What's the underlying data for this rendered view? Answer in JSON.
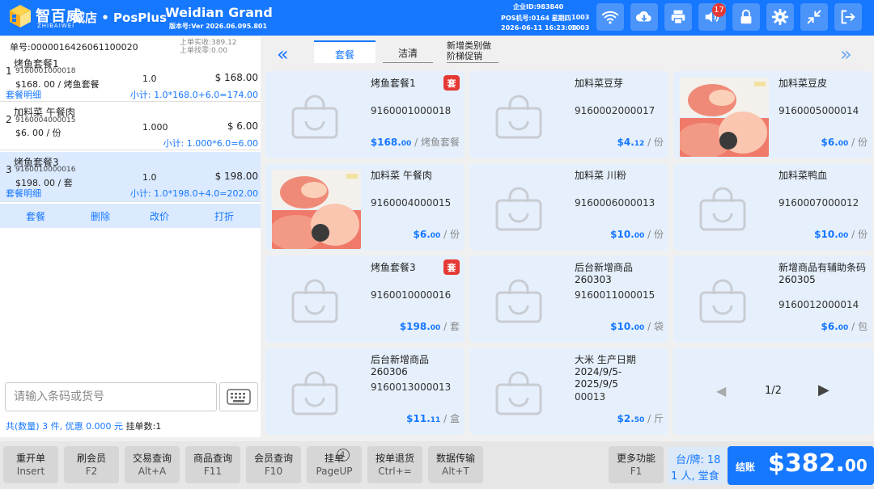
{
  "header": {
    "brand_cn": "智百威",
    "brand_en": "ZHIBAIWEI",
    "app_title": "威店 • PosPlus",
    "store_name": "Weidian Grand",
    "version": "版本号:Ver 2026.06.095.801",
    "enterprise_id": "企业ID:983840",
    "pos_line": "POS机号:0164  星期四",
    "pos_right": "1003",
    "datetime": "2026-06-11 16:23:00",
    "datetime_right": "1003",
    "volume_badge": "17",
    "icons": [
      "wifi-icon",
      "cloud-download-icon",
      "printer-icon",
      "volume-icon",
      "lock-icon",
      "gear-icon",
      "minimize-icon",
      "exit-icon"
    ]
  },
  "order": {
    "order_no": "单号:0000016426061100020",
    "prev_paid": "上单实收:389.12",
    "prev_change": "上单找零:0.00",
    "items": [
      {
        "idx": "1",
        "name": "烤鱼套餐1",
        "code": "9160001000018",
        "price": "$168. 00 / 烤鱼套餐",
        "qty": "1.0",
        "total": "$ 168.00",
        "link": "套餐明细",
        "subtotal": "小计: 1.0*168.0+6.0=174.00"
      },
      {
        "idx": "2",
        "name": "加料菜 午餐肉",
        "code": "9160004000015",
        "price": "$6. 00 / 份",
        "qty": "1.000",
        "total": "$ 6.00",
        "link": "",
        "subtotal": "小计: 1.000*6.0=6.00"
      },
      {
        "idx": "3",
        "name": "烤鱼套餐3",
        "code": "9160010000016",
        "price": "$198. 00 / 套",
        "qty": "1.0",
        "total": "$ 198.00",
        "link": "套餐明细",
        "subtotal": "小计: 1.0*198.0+4.0=202.00"
      }
    ],
    "actions": [
      "套餐",
      "删除",
      "改价",
      "打折"
    ],
    "search_placeholder": "请输入条码或货号",
    "summary_count": "共(数量) 3 件, 优惠 0.000 元",
    "summary_hang": "挂单数:1"
  },
  "categories": {
    "tabs": [
      "套餐",
      "洁清",
      "新增类别做阶梯促销"
    ],
    "active": "套餐"
  },
  "products": [
    {
      "name": "烤鱼套餐1",
      "code": "9160001000018",
      "price_int": "$168.",
      "price_dec": "00",
      "unit": "/ 烤鱼套餐",
      "badge": "套",
      "image": "placeholder"
    },
    {
      "name": "加料菜豆芽",
      "code": "9160002000017",
      "price_int": "$4.",
      "price_dec": "12",
      "unit": "/ 份",
      "badge": "",
      "image": "placeholder"
    },
    {
      "name": "加料菜豆皮",
      "code": "9160005000014",
      "price_int": "$6.",
      "price_dec": "00",
      "unit": "/ 份",
      "badge": "",
      "image": "photo"
    },
    {
      "name": "加料菜 午餐肉",
      "code": "9160004000015",
      "price_int": "$6.",
      "price_dec": "00",
      "unit": "/ 份",
      "badge": "",
      "image": "photo"
    },
    {
      "name": "加料菜 川粉",
      "code": "9160006000013",
      "price_int": "$10.",
      "price_dec": "00",
      "unit": "/ 份",
      "badge": "",
      "image": "placeholder"
    },
    {
      "name": "加料菜鸭血",
      "code": "9160007000012",
      "price_int": "$10.",
      "price_dec": "00",
      "unit": "/ 份",
      "badge": "",
      "image": "placeholder"
    },
    {
      "name": "烤鱼套餐3",
      "code": "9160010000016",
      "price_int": "$198.",
      "price_dec": "00",
      "unit": "/ 套",
      "badge": "套",
      "image": "placeholder"
    },
    {
      "name": "后台新增商品260303",
      "code": "9160011000015",
      "price_int": "$10.",
      "price_dec": "00",
      "unit": "/ 袋",
      "badge": "",
      "image": "placeholder"
    },
    {
      "name": "新增商品有辅助条码260305",
      "code": "9160012000014",
      "price_int": "$6.",
      "price_dec": "00",
      "unit": "/ 包",
      "badge": "",
      "image": "placeholder"
    },
    {
      "name": "后台新增商品260306",
      "code": "9160013000013",
      "price_int": "$11.",
      "price_dec": "11",
      "unit": "/ 盒",
      "badge": "",
      "image": "placeholder"
    },
    {
      "name": "大米   生产日期 2024/9/5-2025/9/5",
      "code": "00013",
      "price_int": "$2.",
      "price_dec": "50",
      "unit": "/ 斤",
      "badge": "",
      "image": "placeholder"
    }
  ],
  "pager": {
    "text": "1/2"
  },
  "footer": {
    "buttons": [
      {
        "label": "重开单",
        "key": "Insert"
      },
      {
        "label": "刷会员",
        "key": "F2"
      },
      {
        "label": "交易查询",
        "key": "Alt+A"
      },
      {
        "label": "商品查询",
        "key": "F11"
      },
      {
        "label": "会员查询",
        "key": "F10"
      },
      {
        "label": "挂单",
        "key": "PageUP"
      },
      {
        "label": "按单退货",
        "key": "Ctrl+="
      },
      {
        "label": "数据传输",
        "key": "Alt+T"
      },
      {
        "label": "更多功能",
        "key": "F1"
      }
    ],
    "hang_badge": "1",
    "table_line1": "台/牌: 18",
    "table_line2": "1 人, 堂食",
    "checkout_label": "结账",
    "checkout_int": "$382.",
    "checkout_dec": "00"
  },
  "colors": {
    "primary": "#1677ff",
    "badge": "#e53935",
    "card": "#e6f0fc"
  }
}
